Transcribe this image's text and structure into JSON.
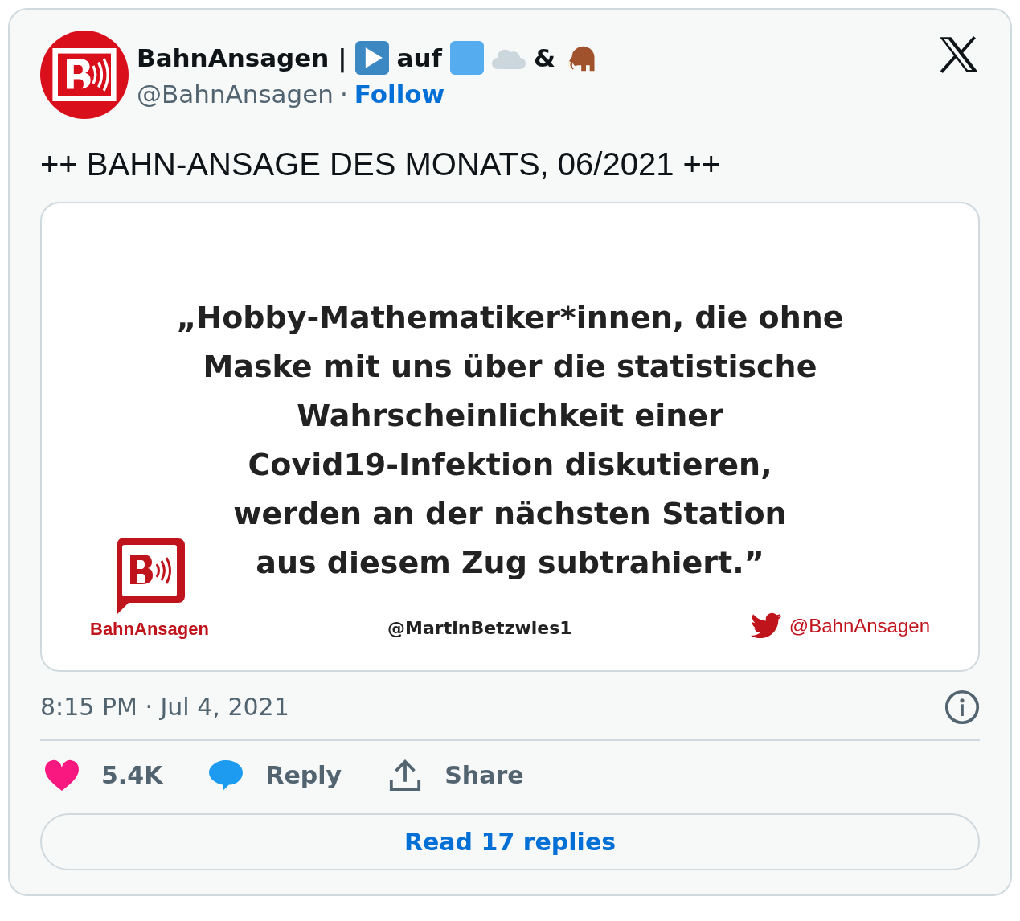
{
  "author": {
    "name_parts": [
      {
        "kind": "text",
        "text": "BahnAnsagen |"
      },
      {
        "kind": "play-emoji"
      },
      {
        "kind": "text",
        "text": "auf"
      },
      {
        "kind": "square-emoji"
      },
      {
        "kind": "cloud-emoji"
      },
      {
        "kind": "text",
        "text": "&"
      },
      {
        "kind": "mammoth-emoji"
      }
    ],
    "handle": "@BahnAnsagen",
    "separator": "·",
    "follow": "Follow"
  },
  "text": "++ BAHN-ANSAGE DES MONATS, 06/2021 ++",
  "media": {
    "quote": "„Hobby-Mathematiker*innen, die ohne\nMaske mit uns über die statistische\nWahrscheinlichkeit einer\nCovid19-Infektion diskutieren,\nwerden an der nächsten Station\naus diesem Zug subtrahiert.”",
    "logo_caption": "BahnAnsagen",
    "credit": "@MartinBetzwies1",
    "twitter_handle": "@BahnAnsagen"
  },
  "timestamp": "8:15 PM · Jul 4, 2021",
  "actions": [
    {
      "kind": "like",
      "label": "5.4K"
    },
    {
      "kind": "reply",
      "label": "Reply"
    },
    {
      "kind": "share",
      "label": "Share"
    }
  ],
  "read_replies": "Read 17 replies"
}
